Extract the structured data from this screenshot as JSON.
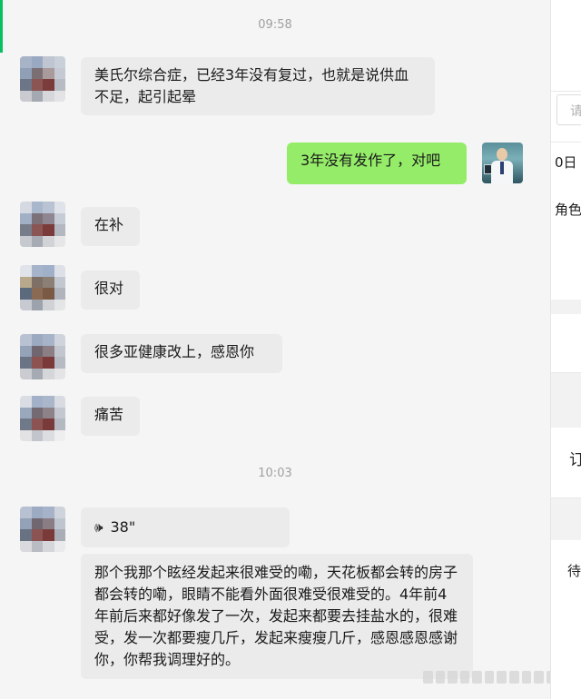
{
  "chat": {
    "times": [
      "09:58",
      "10:03"
    ],
    "messages": [
      {
        "from": "other",
        "text": "美氏尔综合症，已经3年没有复过，也就是说供血不足，起引起晕"
      },
      {
        "from": "me",
        "text": "3年没有发作了，对吧"
      },
      {
        "from": "other",
        "text": "在补"
      },
      {
        "from": "other",
        "text": "很对"
      },
      {
        "from": "other",
        "text": "很多亚健康改上，感恩你"
      },
      {
        "from": "other",
        "text": "痛苦"
      },
      {
        "from": "other",
        "type": "voice",
        "duration": "38\"",
        "icon": "voice-wave-icon"
      },
      {
        "from": "other",
        "text": "那个我那个眩经发起来很难受的嘞，天花板都会转的房子都会转的嘞，眼睛不能看外面很难受很难受的。4年前4年前后来都好像发了一次，发起来都要去挂盐水的，很难受，发一次都要瘦几斤，发起来瘦瘦几斤，感恩感恩感谢你，你帮我调理好的。"
      }
    ]
  },
  "side_panel": {
    "input_placeholder_fragment": "请",
    "fragments": [
      "0日",
      "角色",
      "订",
      "待"
    ]
  },
  "colors": {
    "accent": "#07c160",
    "bubble_other": "#ebebeb",
    "bubble_me": "#95ec69",
    "chat_bg": "#f5f5f5"
  }
}
